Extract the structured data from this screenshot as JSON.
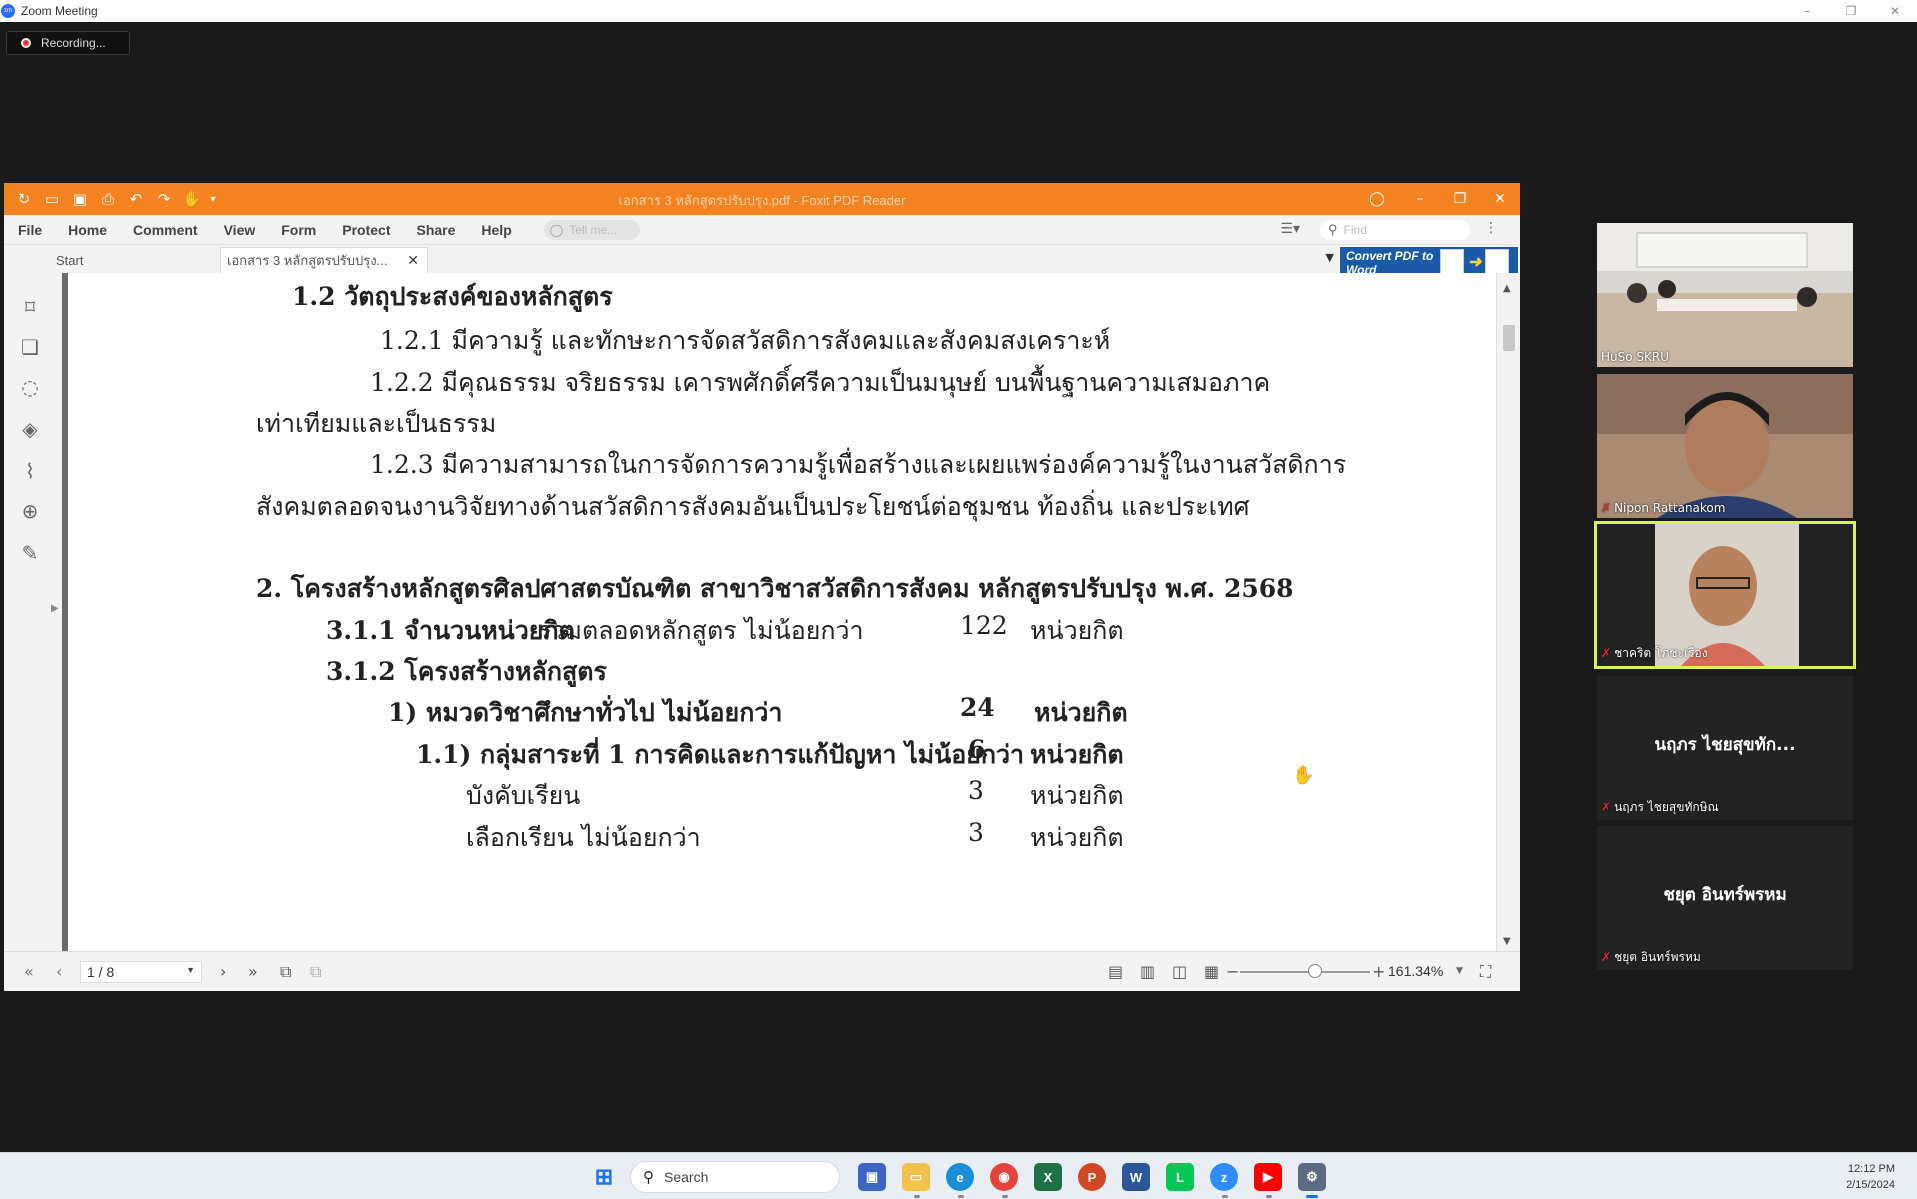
{
  "zoom": {
    "window_title": "Zoom Meeting",
    "logo_text": "zm",
    "recording_label": "Recording...",
    "window_controls": [
      "–",
      "❐",
      "✕"
    ]
  },
  "foxit": {
    "title": "เอกสาร 3 หลักสูตรปรับปรุง.pdf - Foxit PDF Reader",
    "menu": [
      "File",
      "Home",
      "Comment",
      "View",
      "Form",
      "Protect",
      "Share",
      "Help"
    ],
    "tellme_placeholder": "Tell me...",
    "find_placeholder": "Find",
    "tabs": [
      {
        "label": "Start"
      },
      {
        "label": "เอกสาร 3 หลักสูตรปรับปรุง..."
      }
    ],
    "convert_button": "Convert PDF to Word",
    "page_indicator": "1 / 8",
    "zoom_level": "161.34%",
    "accent_color": "#f58220"
  },
  "document": {
    "heading_1_2": "1.2  วัตถุประสงค์ของหลักสูตร",
    "obj_1": "1.2.1  มีความรู้ และทักษะการจัดสวัสดิการสังคมและสังคมสงเคราะห์",
    "obj_2a": "1.2.2  มีคุณธรรม  จริยธรรม  เคารพศักดิ์ศรีความเป็นมนุษย์  บนพื้นฐานความเสมอภาค",
    "obj_2b": "เท่าเทียมและเป็นธรรม",
    "obj_3a": "1.2.3  มีความสามารถในการจัดการความรู้เพื่อสร้างและเผยแพร่องค์ความรู้ในงานสวัสดิการ",
    "obj_3b": "สังคมตลอดจนงานวิจัยทางด้านสวัสดิการสังคมอันเป็นประโยชน์ต่อชุมชน  ท้องถิ่น และประเทศ",
    "heading_2": "2. โครงสร้างหลักสูตรศิลปศาสตรบัณฑิต  สาขาวิชาสวัสดิการสังคม  หลักสูตรปรับปรุง  พ.ศ. 2568",
    "row_311_label": "3.1.1  จำนวนหน่วยกิต",
    "row_311_desc": "รวมตลอดหลักสูตร ไม่น้อยกว่า",
    "row_311_val": "122",
    "unit": "หน่วยกิต",
    "row_312": "3.1.2  โครงสร้างหลักสูตร",
    "row_1_label": "1) หมวดวิชาศึกษาทั่วไป  ไม่น้อยกว่า",
    "row_1_val": "24",
    "row_11_label": "1.1)  กลุ่มสาระที่  1 การคิดและการแก้ปัญหา  ไม่น้อยกว่า",
    "row_11_val": "6",
    "row_req_label": "บังคับเรียน",
    "row_req_val": "3",
    "row_elec_label": "เลือกเรียน  ไม่น้อยกว่า",
    "row_elec_val": "3"
  },
  "participants": [
    {
      "name": "HuSo SKRU",
      "muted": false,
      "video": true
    },
    {
      "name": "Nipon Rattanakom",
      "muted": true,
      "video": true
    },
    {
      "name": "ชาคริต โภชะเรือง",
      "muted": true,
      "video": true,
      "active": true
    },
    {
      "name": "นฤภร  ไชยสุขทัก...",
      "display": "นฤภร  ไชยสุขทักษิณ",
      "muted": true,
      "video": false
    },
    {
      "name": "ชยุต อินทร์พรหม",
      "display": "ชยุต อินทร์พรหม",
      "muted": true,
      "video": false
    }
  ],
  "taskbar": {
    "search_placeholder": "Search",
    "time": "12:12 PM",
    "date": "2/15/2024"
  }
}
